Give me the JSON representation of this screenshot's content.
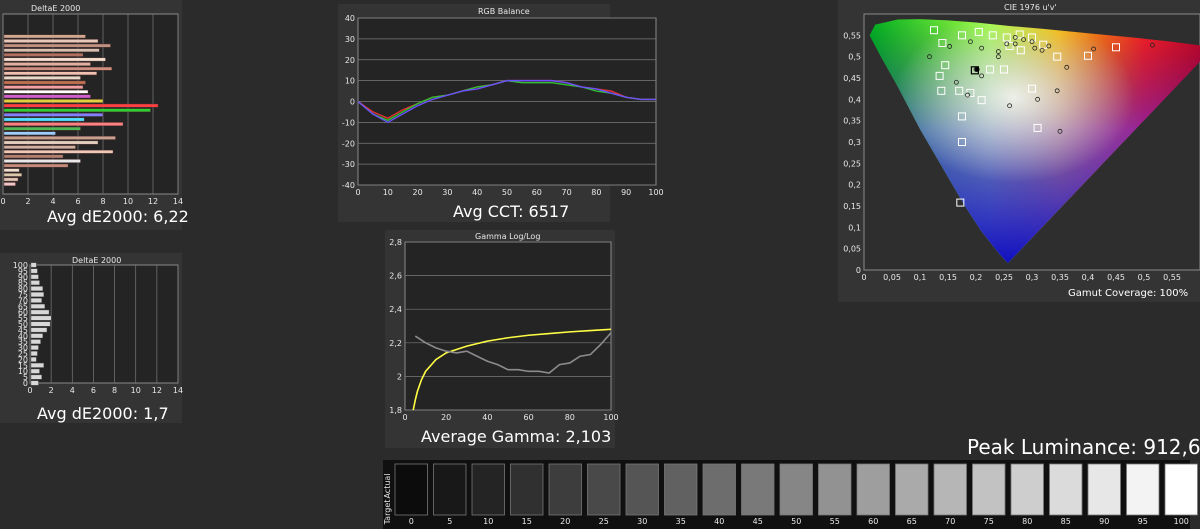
{
  "colors": {
    "background": "#2b2b2b",
    "panel": "#343434",
    "plot": "#242424",
    "grid": "#7a7a7a",
    "gamma_target": "#ffff44",
    "gamma_actual": "#8c8c8c"
  },
  "chart_data": [
    {
      "id": "delta_color",
      "type": "bar",
      "orientation": "horizontal",
      "title": "DeltaE 2000",
      "xlim": [
        0,
        14
      ],
      "x_ticks": [
        "0",
        "2",
        "4",
        "6",
        "8",
        "10",
        "12",
        "14"
      ],
      "values": [
        1.0,
        1.2,
        1.5,
        1.3,
        5.2,
        6.2,
        4.8,
        8.8,
        5.8,
        7.6,
        9.0,
        4.2,
        6.2,
        9.6,
        6.5,
        8.0,
        11.8,
        12.4,
        8.0,
        7.0,
        6.8,
        6.4,
        6.6,
        6.2,
        7.5,
        8.7,
        7.0,
        8.2,
        6.4,
        7.7,
        8.6,
        7.6,
        6.6
      ],
      "caption": "Avg dE2000: 6,22"
    },
    {
      "id": "delta_grey",
      "type": "bar",
      "orientation": "horizontal",
      "title": "DeltaE 2000",
      "xlim": [
        0,
        14
      ],
      "x_ticks": [
        "0",
        "2",
        "4",
        "6",
        "8",
        "10",
        "12",
        "14"
      ],
      "y_ticks": [
        "0",
        "5",
        "10",
        "15",
        "20",
        "25",
        "30",
        "35",
        "40",
        "45",
        "50",
        "55",
        "60",
        "65",
        "70",
        "75",
        "80",
        "85",
        "90",
        "95",
        "100"
      ],
      "values": [
        0.8,
        1.1,
        0.9,
        1.3,
        0.6,
        0.7,
        0.8,
        1.0,
        1.2,
        1.6,
        1.9,
        2.0,
        1.8,
        1.4,
        1.1,
        1.3,
        1.2,
        0.9,
        0.8,
        0.7,
        0.6
      ],
      "caption": "Avg dE2000: 1,7"
    },
    {
      "id": "rgb_balance",
      "type": "line",
      "title": "RGB Balance",
      "xlim": [
        0,
        100
      ],
      "ylim": [
        -40,
        40
      ],
      "x_ticks": [
        "0",
        "10",
        "20",
        "30",
        "40",
        "50",
        "60",
        "70",
        "80",
        "90",
        "100"
      ],
      "y_ticks": [
        "-40",
        "-30",
        "-20",
        "-10",
        "0",
        "10",
        "20",
        "30",
        "40"
      ],
      "x": [
        0,
        5,
        10,
        15,
        20,
        25,
        30,
        35,
        40,
        45,
        50,
        55,
        60,
        65,
        70,
        75,
        80,
        85,
        90,
        95,
        100
      ],
      "series": [
        {
          "color": "#e53030",
          "values": [
            0,
            -5,
            -8,
            -4,
            -1,
            2,
            3,
            5,
            7,
            8,
            10,
            10,
            10,
            10,
            9,
            7,
            6,
            5,
            2,
            1,
            1
          ]
        },
        {
          "color": "#30c030",
          "values": [
            0,
            -6,
            -9,
            -5,
            -1,
            2,
            3,
            5,
            7,
            8,
            10,
            9,
            9,
            9,
            8,
            7,
            5,
            4,
            2,
            1,
            1
          ]
        },
        {
          "color": "#6a50ff",
          "values": [
            0,
            -6,
            -10,
            -6,
            -2,
            1,
            3,
            5,
            6,
            8,
            10,
            10,
            10,
            10,
            9,
            7,
            6,
            4,
            2,
            1,
            1
          ]
        }
      ],
      "caption": "Avg CCT: 6517"
    },
    {
      "id": "gamma",
      "type": "line",
      "title": "Gamma Log/Log",
      "xlim": [
        0,
        100
      ],
      "ylim": [
        1.8,
        2.8
      ],
      "x_ticks": [
        "0",
        "20",
        "40",
        "60",
        "80",
        "100"
      ],
      "y_ticks": [
        "1,8",
        "2",
        "2,2",
        "2,4",
        "2,6",
        "2,8"
      ],
      "series": [
        {
          "color": "#ffff44",
          "x": [
            4,
            5,
            6,
            8,
            10,
            15,
            20,
            30,
            40,
            50,
            60,
            70,
            80,
            90,
            100
          ],
          "values": [
            1.8,
            1.86,
            1.91,
            1.98,
            2.03,
            2.1,
            2.14,
            2.18,
            2.21,
            2.23,
            2.245,
            2.255,
            2.265,
            2.273,
            2.28
          ]
        },
        {
          "color": "#8c8c8c",
          "x": [
            5,
            10,
            15,
            20,
            25,
            30,
            35,
            40,
            45,
            50,
            55,
            60,
            65,
            70,
            75,
            80,
            85,
            90,
            95,
            100
          ],
          "values": [
            2.24,
            2.2,
            2.17,
            2.15,
            2.14,
            2.15,
            2.12,
            2.09,
            2.07,
            2.04,
            2.04,
            2.03,
            2.03,
            2.02,
            2.07,
            2.08,
            2.12,
            2.13,
            2.19,
            2.26
          ]
        }
      ],
      "caption": "Average Gamma: 2,103"
    },
    {
      "id": "cie",
      "type": "scatter",
      "title": "CIE 1976 u'v'",
      "xlim": [
        0,
        0.6
      ],
      "ylim": [
        0,
        0.6
      ],
      "x_ticks": [
        "0",
        "0,05",
        "0,1",
        "0,15",
        "0,2",
        "0,25",
        "0,3",
        "0,35",
        "0,4",
        "0,45",
        "0,5",
        "0,55"
      ],
      "y_ticks": [
        "0",
        "0,05",
        "0,1",
        "0,15",
        "0,2",
        "0,25",
        "0,3",
        "0,35",
        "0,4",
        "0,45",
        "0,5",
        "0,55"
      ],
      "targets": [
        [
          0.125,
          0.562
        ],
        [
          0.14,
          0.532
        ],
        [
          0.175,
          0.55
        ],
        [
          0.205,
          0.558
        ],
        [
          0.23,
          0.55
        ],
        [
          0.255,
          0.545
        ],
        [
          0.278,
          0.552
        ],
        [
          0.3,
          0.545
        ],
        [
          0.32,
          0.528
        ],
        [
          0.345,
          0.5
        ],
        [
          0.4,
          0.502
        ],
        [
          0.45,
          0.522
        ],
        [
          0.145,
          0.48
        ],
        [
          0.135,
          0.455
        ],
        [
          0.138,
          0.42
        ],
        [
          0.17,
          0.42
        ],
        [
          0.19,
          0.415
        ],
        [
          0.21,
          0.398
        ],
        [
          0.25,
          0.47
        ],
        [
          0.3,
          0.425
        ],
        [
          0.31,
          0.333
        ],
        [
          0.175,
          0.36
        ],
        [
          0.175,
          0.3
        ],
        [
          0.172,
          0.158
        ],
        [
          0.225,
          0.47
        ],
        [
          0.28,
          0.515
        ],
        [
          0.26,
          0.525
        ]
      ],
      "measured": [
        [
          0.117,
          0.5
        ],
        [
          0.153,
          0.524
        ],
        [
          0.19,
          0.535
        ],
        [
          0.21,
          0.52
        ],
        [
          0.24,
          0.512
        ],
        [
          0.255,
          0.53
        ],
        [
          0.27,
          0.53
        ],
        [
          0.285,
          0.54
        ],
        [
          0.3,
          0.535
        ],
        [
          0.305,
          0.52
        ],
        [
          0.318,
          0.515
        ],
        [
          0.33,
          0.525
        ],
        [
          0.362,
          0.475
        ],
        [
          0.41,
          0.518
        ],
        [
          0.515,
          0.527
        ],
        [
          0.165,
          0.44
        ],
        [
          0.185,
          0.41
        ],
        [
          0.21,
          0.455
        ],
        [
          0.2,
          0.47
        ],
        [
          0.26,
          0.385
        ],
        [
          0.31,
          0.4
        ],
        [
          0.345,
          0.42
        ],
        [
          0.35,
          0.325
        ],
        [
          0.27,
          0.545
        ],
        [
          0.24,
          0.5
        ]
      ],
      "white_target": [
        0.198,
        0.468
      ],
      "white_measured": [
        0.202,
        0.47
      ],
      "caption": "Gamut Coverage:  100%"
    }
  ],
  "ramp": {
    "labels": [
      "0",
      "5",
      "10",
      "15",
      "20",
      "25",
      "30",
      "35",
      "40",
      "45",
      "50",
      "55",
      "60",
      "65",
      "70",
      "75",
      "80",
      "85",
      "90",
      "95",
      "100"
    ],
    "side_labels": [
      "Actual",
      "Target"
    ],
    "caption": "Peak Luminance: 912,6"
  }
}
